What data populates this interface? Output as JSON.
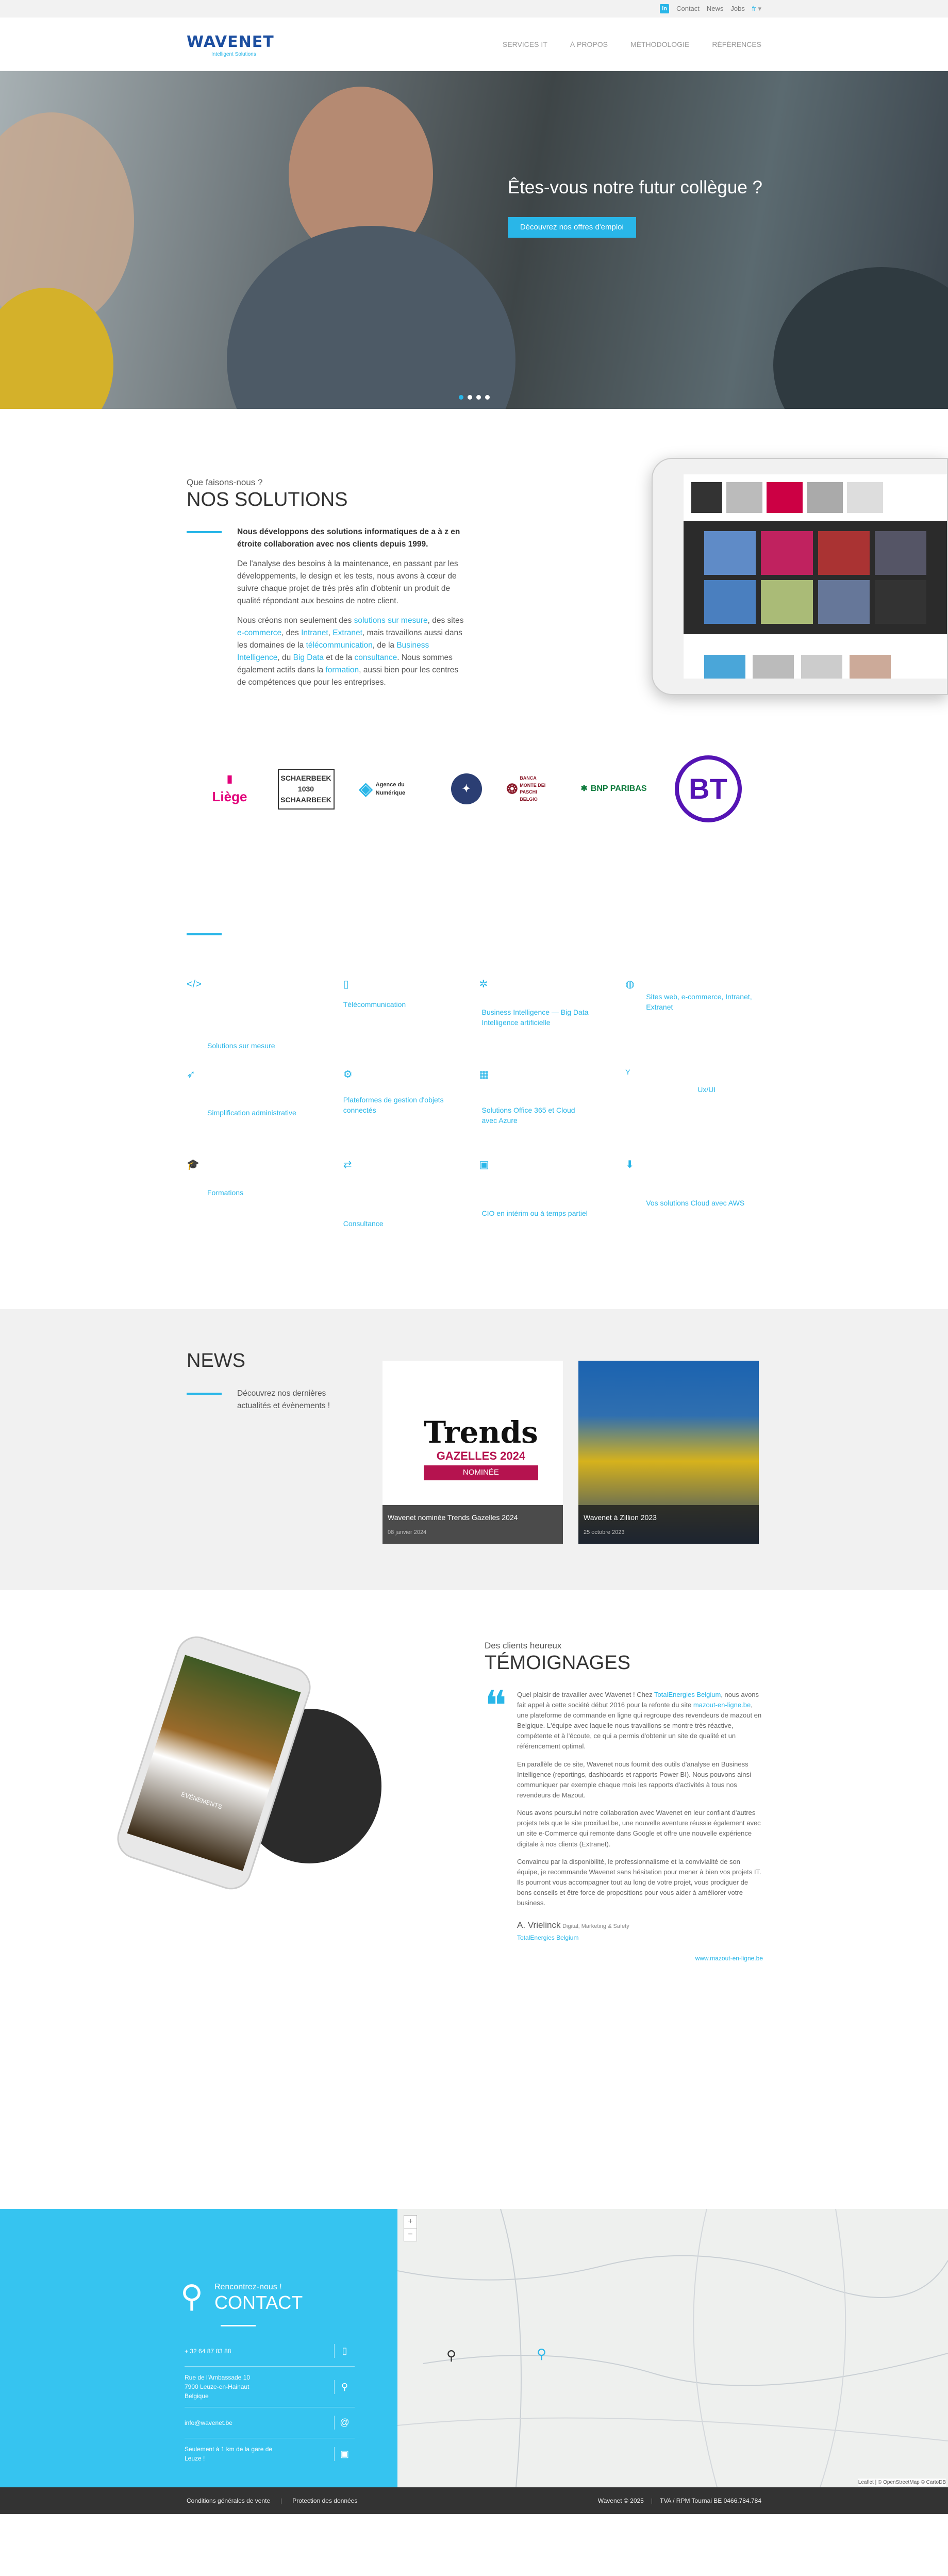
{
  "topbar": {
    "linkedin": "in",
    "links": [
      "Contact",
      "News",
      "Jobs"
    ],
    "lang": "fr"
  },
  "header": {
    "logo": "WAVENET",
    "logo_sub": "Intelligent Solutions",
    "nav": [
      "SERVICES IT",
      "À PROPOS",
      "MÉTHODOLOGIE",
      "RÉFÉRENCES"
    ]
  },
  "hero": {
    "title": "Êtes-vous notre futur collègue ?",
    "button": "Découvrez nos offres d'emploi"
  },
  "solutions": {
    "kicker": "Que faisons-nous ?",
    "title": "NOS SOLUTIONS",
    "p1": "Nous développons des solutions informatiques de a à z en étroite collaboration avec nos clients depuis 1999.",
    "p2": "De l'analyse des besoins à la maintenance, en passant par les développements, le design et les tests, nous avons à cœur de suivre chaque projet de très près afin d'obtenir un produit de qualité répondant aux besoins de notre client.",
    "p3a": "Nous créons non seulement des ",
    "p3_l1": "solutions sur mesure",
    "p3b": ", des sites ",
    "p3_l2": "e-commerce",
    "p3c": ", des ",
    "p3_l3": "Intranet",
    "p3d": ", ",
    "p3_l4": "Extranet",
    "p3e": ", mais travaillons aussi dans les domaines de la ",
    "p3_l5": "télécommunication",
    "p3f": ", de la ",
    "p3_l6": "Business Intelligence",
    "p3g": ", du ",
    "p3_l7": "Big Data",
    "p3h": " et de la ",
    "p3_l8": "consultance",
    "p3i": ". Nous sommes également actifs dans la ",
    "p3_l9": "formation",
    "p3j": ", aussi bien pour les centres de compétences que pour les entreprises."
  },
  "clients": [
    "Liège",
    "SCHAERBEEK 1030 SCHAARBEEK",
    "Agence du Numérique",
    "",
    "BANCA MONTE DEI PASCHI BELGIO",
    "BNP PARIBAS",
    "BT"
  ],
  "services": [
    {
      "icon": "</>",
      "label": "Solutions sur mesure"
    },
    {
      "icon": "▯",
      "label": "Télécommunication"
    },
    {
      "icon": "✲",
      "label": "Business Intelligence — Big Data\nIntelligence artificielle"
    },
    {
      "icon": "◍",
      "label": "Sites web, e-commerce, Intranet,\nExtranet"
    },
    {
      "icon": "➶",
      "label": "Simplification administrative"
    },
    {
      "icon": "⚙",
      "label": "Plateformes de gestion d'objets\nconnectés"
    },
    {
      "icon": "▦",
      "label": "Solutions Office 365 et Cloud\navec Azure"
    },
    {
      "icon": "Y",
      "label": "Ux/UI"
    },
    {
      "icon": "🎓",
      "label": "Formations"
    },
    {
      "icon": "⇄",
      "label": "Consultance"
    },
    {
      "icon": "▣",
      "label": "CIO en intérim ou à temps partiel"
    },
    {
      "icon": "⬇",
      "label": "Vos solutions Cloud avec AWS"
    }
  ],
  "news": {
    "title": "NEWS",
    "intro": "Découvrez nos dernières actualités et évènements !",
    "items": [
      {
        "title": "Wavenet nominée Trends Gazelles 2024",
        "date": "08 janvier 2024",
        "brand": "Trends",
        "sub": "GAZELLES 2024",
        "badge": "NOMINÉE"
      },
      {
        "title": "Wavenet à Zillion 2023",
        "date": "25 octobre 2023"
      }
    ]
  },
  "testimonials": {
    "kicker": "Des clients heureux",
    "title": "TÉMOIGNAGES",
    "p1a": "Quel plaisir de travailler avec Wavenet ! Chez ",
    "p1_l1": "TotalEnergies Belgium",
    "p1b": ", nous avons fait appel à cette société début 2016 pour la refonte du site ",
    "p1_l2": "mazout-en-ligne.be",
    "p1c": ", une plateforme de commande en ligne qui regroupe des revendeurs de mazout en Belgique. L'équipe avec laquelle nous travaillons se montre très réactive, compétente et à l'écoute, ce qui a permis d'obtenir un site de qualité et un référencement optimal.",
    "p2": "En parallèle de ce site, Wavenet nous fournit des outils d'analyse en Business Intelligence (reportings, dashboards et rapports Power BI). Nous pouvons ainsi communiquer par exemple chaque mois les rapports d'activités à tous nos revendeurs de Mazout.",
    "p3": "Nous avons poursuivi notre collaboration avec Wavenet en leur confiant d'autres projets tels que le site proxifuel.be, une nouvelle aventure réussie également avec un site e-Commerce qui remonte dans Google et offre une nouvelle expérience digitale à nos clients (Extranet).",
    "p4": "Convaincu par la disponibilité, le professionnalisme et la convivialité de son équipe, je recommande Wavenet sans hésitation pour mener à bien vos projets IT. Ils pourront vous accompagner tout au long de votre projet, vous prodiguer de bons conseils et être force de propositions pour vous aider à améliorer votre business.",
    "author": "A. Vrielinck",
    "role": "Digital, Marketing & Safety",
    "company": "TotalEnergies Belgium",
    "site": "www.mazout-en-ligne.be",
    "phone_text": "ÉVÉNEMENTS"
  },
  "contact": {
    "kicker": "Rencontrez-nous !",
    "title": "CONTACT",
    "phone": "+ 32 64 87 83 88",
    "address": "Rue de l'Ambassade 10\n7900 Leuze-en-Hainaut\nBelgique",
    "email": "info@wavenet.be",
    "train": "Seulement à 1 km de la gare de Leuze !",
    "map_zoom_in": "+",
    "map_zoom_out": "−",
    "map_credit": "Leaflet | © OpenStreetMap © CartoDB"
  },
  "footer": {
    "links": [
      "Conditions générales de vente",
      "Protection des données"
    ],
    "copy": "Wavenet © 2025",
    "tva": "TVA / RPM Tournai BE 0466.784.784"
  }
}
